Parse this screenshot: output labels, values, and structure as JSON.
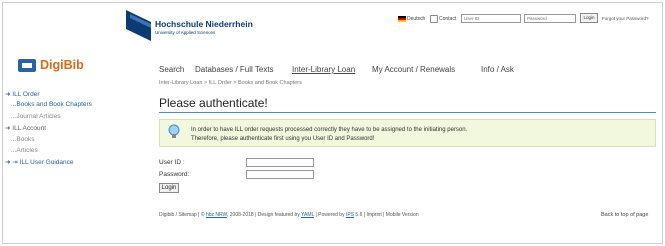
{
  "header": {
    "university_name": "Hochschule Niederrhein",
    "university_subtitle": "University of Applied Sciences",
    "language_label": "Deutsch",
    "contact_label": "Contact",
    "user_id_placeholder": "User ID",
    "password_placeholder": "Password",
    "login_label": "Login",
    "forgot_label": "Forgot your Password?"
  },
  "brand": {
    "name": "DigiBib"
  },
  "nav": {
    "items": [
      {
        "label": "Search"
      },
      {
        "label": "Databases / Full Texts"
      },
      {
        "label": "Inter-Library Loan"
      },
      {
        "label": "My Account / Renewals"
      },
      {
        "label": "Info / Ask"
      }
    ],
    "active_index": 2
  },
  "sidebar": {
    "items": [
      {
        "label": "ILL Order"
      },
      {
        "label": "...Books and Book Chapters"
      },
      {
        "label": "...Journal Articles"
      },
      {
        "label": "ILL Account"
      },
      {
        "label": "...Books"
      },
      {
        "label": "...Articles"
      },
      {
        "label": "ILL User Guidance"
      }
    ]
  },
  "breadcrumb": "Inter-Library Loan > ILL Order > Books and Book Chapters",
  "main": {
    "title": "Please authenticate!",
    "info_line1": "In order to have ILL order requests processed correctly they have to be assigned to the initiating person.",
    "info_line2": "Therefore, please authenticate first using you User ID and Password!",
    "user_id_label": "User ID :",
    "password_label": "Password:",
    "login_button": "Login"
  },
  "footer": {
    "part1": "Digibib / Sitemap | © ",
    "hbz": "hbz NRW",
    "part2": ", 2008-2018 | Design featured by ",
    "yaml": "YAML",
    "part3": " | Powered by ",
    "ips": "IPS",
    "part4": " 5.6 | Imprint | Mobile Version",
    "back_to_top": "Back to top of page"
  },
  "colors": {
    "brand_orange": "#d86a1a",
    "link_blue": "#2a62a7",
    "info_bg": "#f2f8dd",
    "uni_blue": "#0c3b74"
  }
}
